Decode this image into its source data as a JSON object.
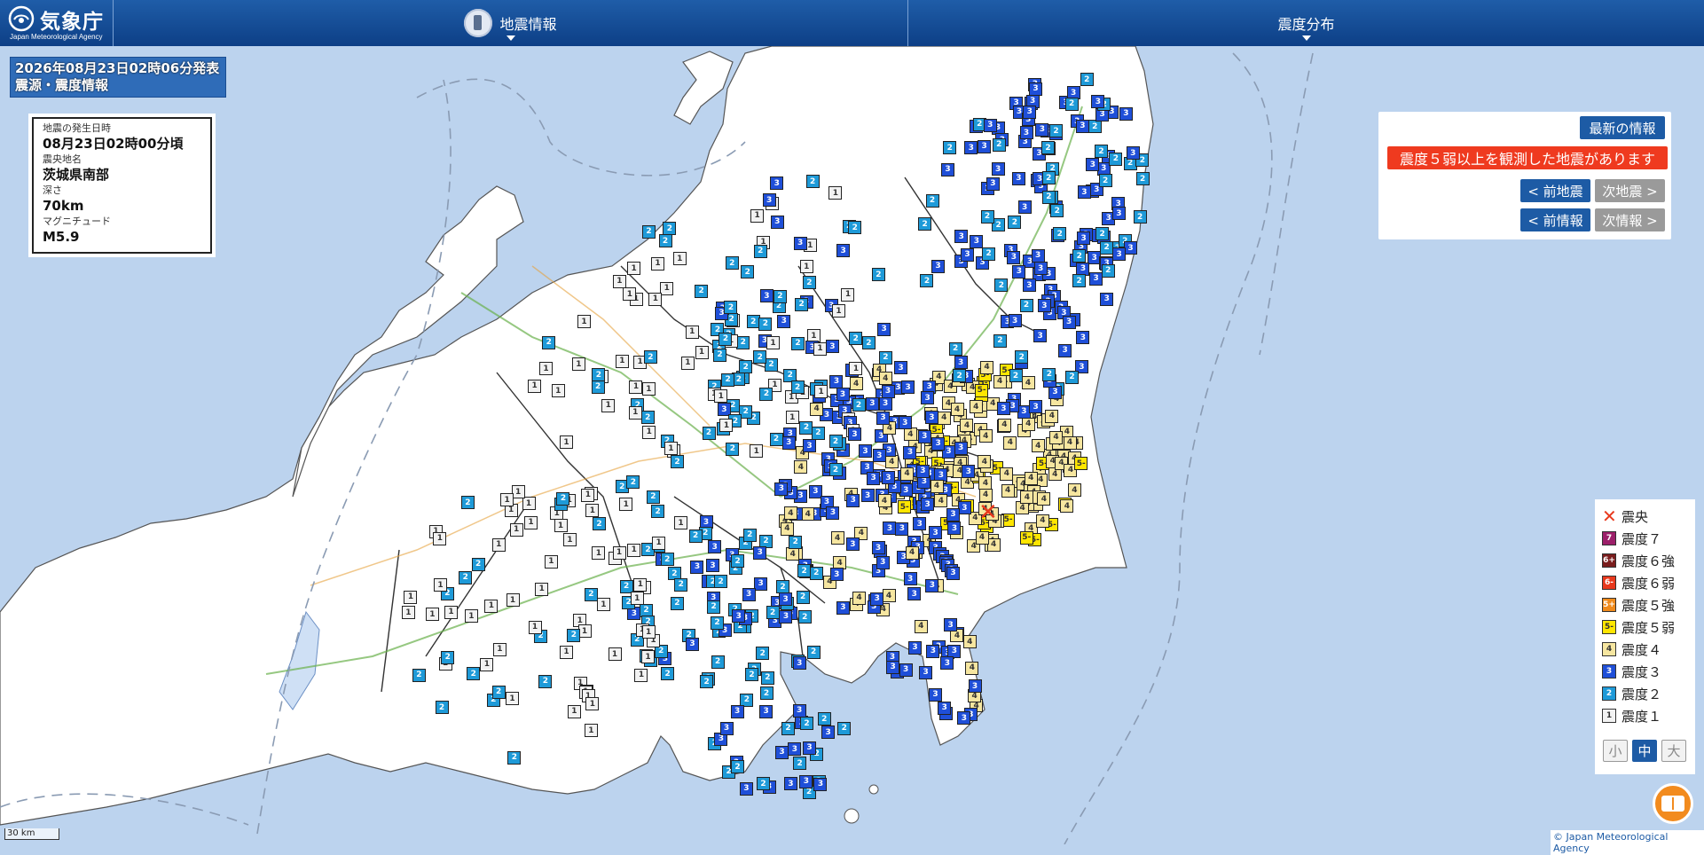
{
  "header": {
    "agency_name": "気象庁",
    "agency_name_en": "Japan Meteorological Agency",
    "menu_earthquake": "地震情報",
    "menu_intensity": "震度分布"
  },
  "issue": {
    "datetime": "2026年08月23日02時06分発表",
    "title": "震源・震度情報"
  },
  "quake": {
    "time_label": "地震の発生日時",
    "time": "08月23日02時00分頃",
    "place_label": "震央地名",
    "place": "茨城県南部",
    "depth_label": "深さ",
    "depth": "70km",
    "mag_label": "マグニチュード",
    "mag": "M5.9"
  },
  "panel": {
    "latest": "最新の情報",
    "alert": "震度５弱以上を観測した地震があります",
    "prev_eq": "< 前地震",
    "next_eq": "次地震 >",
    "prev_report": "< 前情報",
    "next_report": "次情報 >"
  },
  "legend": {
    "epicenter": "震央",
    "items": [
      {
        "label": "震度７",
        "code": "7",
        "color": "#9c1f6a",
        "text": "#ffffff"
      },
      {
        "label": "震度６強",
        "code": "6+",
        "color": "#7a1d1d",
        "text": "#ffffff"
      },
      {
        "label": "震度６弱",
        "code": "6-",
        "color": "#e8391d",
        "text": "#ffffff"
      },
      {
        "label": "震度５強",
        "code": "5+",
        "color": "#f08a1b",
        "text": "#ffffff"
      },
      {
        "label": "震度５弱",
        "code": "5-",
        "color": "#ffe600",
        "text": "#333333"
      },
      {
        "label": "震度４",
        "code": "4",
        "color": "#f6e6a0",
        "text": "#333333"
      },
      {
        "label": "震度３",
        "code": "3",
        "color": "#1f4fd8",
        "text": "#ffffff"
      },
      {
        "label": "震度２",
        "code": "2",
        "color": "#1e9ad8",
        "text": "#ffffff"
      },
      {
        "label": "震度１",
        "code": "1",
        "color": "#f2f2f2",
        "text": "#333333"
      }
    ],
    "size_small": "小",
    "size_medium": "中",
    "size_large": "大"
  },
  "map": {
    "scale": "30 km",
    "copyright": "© Japan Meteorological Agency",
    "epicenter_symbol": "✕"
  }
}
